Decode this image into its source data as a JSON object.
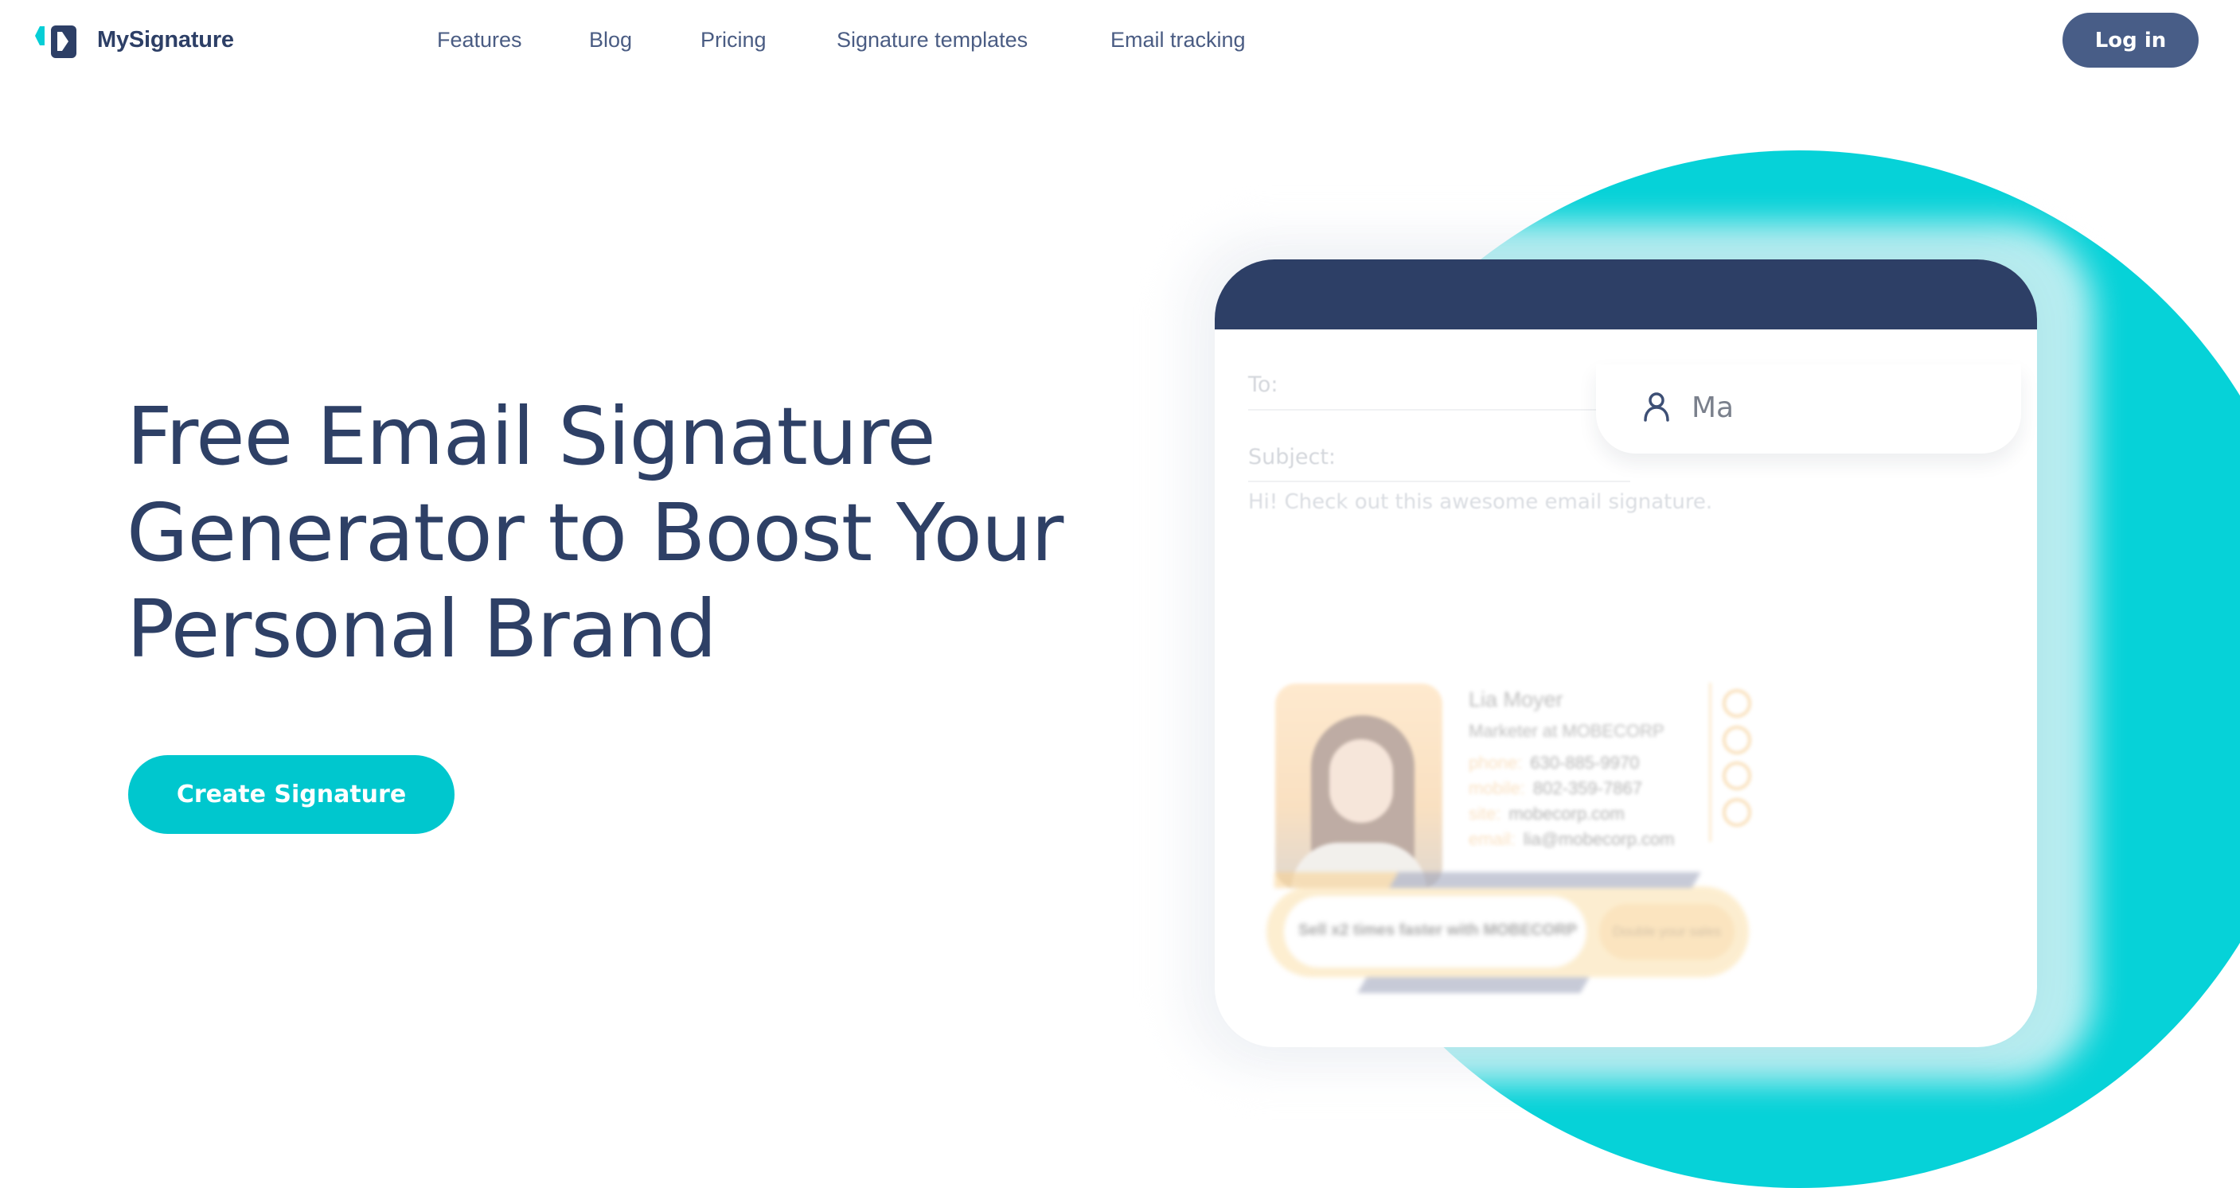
{
  "brand": {
    "name": "MySignature",
    "logo_icon": "mysignature-logo-icon",
    "colors": {
      "primary_dark": "#2d3f66",
      "accent_teal": "#06d2d8",
      "button_teal": "#00c7ce",
      "login_bg": "#485d87"
    }
  },
  "nav": {
    "items": [
      {
        "label": "Features"
      },
      {
        "label": "Blog"
      },
      {
        "label": "Pricing"
      },
      {
        "label": "Signature templates"
      },
      {
        "label": "Email tracking"
      }
    ],
    "login_label": "Log in"
  },
  "hero": {
    "title_lines": [
      "Free Email Signature",
      "Generator to Boost Your",
      "Personal Brand"
    ],
    "cta_label": "Create Signature"
  },
  "email_preview": {
    "to_label": "To:",
    "subject_label": "Subject:",
    "body": "Hi! Check out this awesome email signature.",
    "autocomplete": {
      "icon": "user-icon",
      "text": "Ma"
    },
    "signature": {
      "name": "Lia Moyer",
      "title": "Marketer at MOBECORP",
      "rows": [
        {
          "label": "phone:",
          "value": "630-885-9970"
        },
        {
          "label": "mobile:",
          "value": "802-359-7867"
        },
        {
          "label": "site:",
          "value": "mobecorp.com"
        },
        {
          "label": "email:",
          "value": "lia@mobecorp.com"
        }
      ],
      "social_icons": [
        "facebook-icon",
        "linkedin-icon",
        "twitter-icon",
        "instagram-icon"
      ]
    },
    "banner": {
      "text": "Sell x2 times faster with MOBECORP",
      "button_label": "Double your sales"
    }
  }
}
